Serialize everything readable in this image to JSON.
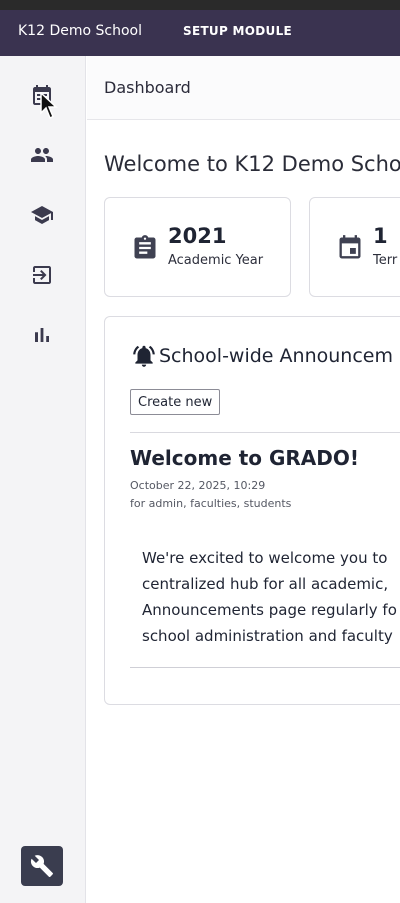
{
  "topbar": {
    "brand": "K12 Demo School",
    "module": "SETUP MODULE"
  },
  "sidebar": {
    "items": [
      {
        "icon": "calendar-icon",
        "name": "dashboard"
      },
      {
        "icon": "people-icon",
        "name": "people"
      },
      {
        "icon": "graduation-cap-icon",
        "name": "academics"
      },
      {
        "icon": "login-icon",
        "name": "enrollment"
      },
      {
        "icon": "bar-chart-icon",
        "name": "reports"
      }
    ],
    "settings_icon": "wrench-icon"
  },
  "breadcrumb": {
    "current": "Dashboard"
  },
  "main": {
    "welcome": "Welcome to K12 Demo Scho",
    "stats": [
      {
        "icon": "clipboard-icon",
        "value": "2021",
        "label": "Academic Year"
      },
      {
        "icon": "calendar-icon",
        "value": "1",
        "label": "Terr"
      }
    ],
    "announcements": {
      "icon": "bell-icon",
      "title": "School-wide Announcem",
      "create_label": "Create new",
      "post": {
        "title": "Welcome to GRADO!",
        "date": "October 22, 2025, 10:29",
        "audience": "for admin, faculties, students",
        "body_lines": [
          "We're excited to welcome you to",
          "centralized hub for all academic,",
          "Announcements page regularly fo",
          "school administration and faculty"
        ]
      }
    }
  },
  "colors": {
    "topbar": "#3a3350",
    "sidebar": "#f4f4f6",
    "settings_button": "#3a3d4f",
    "text": "#1f2433"
  }
}
